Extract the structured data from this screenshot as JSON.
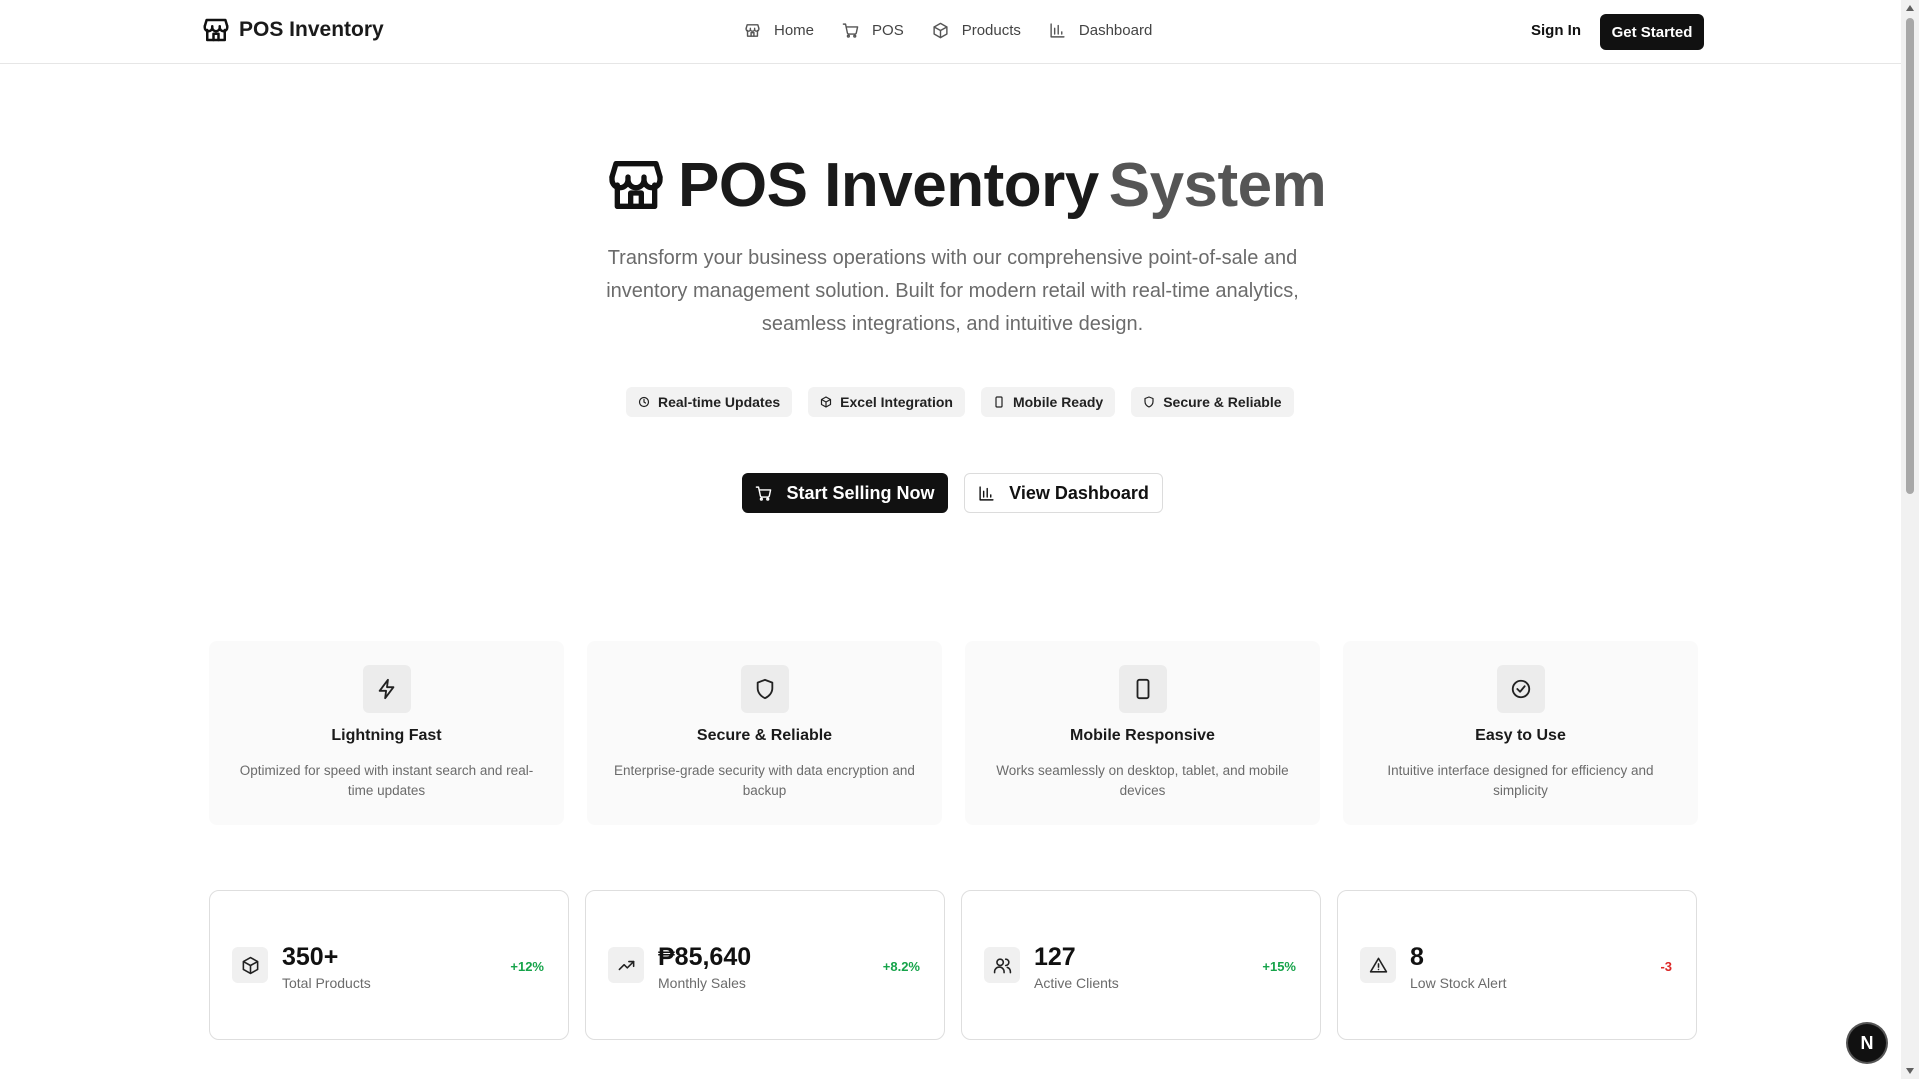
{
  "header": {
    "brand": "POS Inventory",
    "nav": [
      {
        "label": "Home",
        "icon": "store-icon"
      },
      {
        "label": "POS",
        "icon": "cart-icon"
      },
      {
        "label": "Products",
        "icon": "box-icon"
      },
      {
        "label": "Dashboard",
        "icon": "bar-chart-icon"
      }
    ],
    "sign_in": "Sign In",
    "get_started": "Get Started"
  },
  "hero": {
    "title_a": "POS Inventory",
    "title_b": "System",
    "subtitle": "Transform your business operations with our comprehensive point-of-sale and inventory management solution. Built for modern retail with real-time analytics, seamless integrations, and intuitive design.",
    "pills": [
      {
        "label": "Real-time Updates",
        "icon": "clock-icon"
      },
      {
        "label": "Excel Integration",
        "icon": "box-icon"
      },
      {
        "label": "Mobile Ready",
        "icon": "phone-icon"
      },
      {
        "label": "Secure & Reliable",
        "icon": "shield-icon"
      }
    ],
    "primary_cta": "Start Selling Now",
    "secondary_cta": "View Dashboard"
  },
  "features": [
    {
      "title": "Lightning Fast",
      "desc": "Optimized for speed with instant search and real-time updates",
      "icon": "bolt-icon"
    },
    {
      "title": "Secure & Reliable",
      "desc": "Enterprise-grade security with data encryption and backup",
      "icon": "shield-icon"
    },
    {
      "title": "Mobile Responsive",
      "desc": "Works seamlessly on desktop, tablet, and mobile devices",
      "icon": "tablet-icon"
    },
    {
      "title": "Easy to Use",
      "desc": "Intuitive interface designed for efficiency and simplicity",
      "icon": "check-circle-icon"
    }
  ],
  "stats": [
    {
      "value": "350+",
      "label": "Total Products",
      "change": "+12%",
      "icon": "box-icon",
      "color": "#16a34a"
    },
    {
      "value": "₱85,640",
      "label": "Monthly Sales",
      "change": "+8.2%",
      "icon": "trending-up-icon",
      "color": "#16a34a"
    },
    {
      "value": "127",
      "label": "Active Clients",
      "change": "+15%",
      "icon": "users-icon",
      "color": "#16a34a"
    },
    {
      "value": "8",
      "label": "Low Stock Alert",
      "change": "-3",
      "icon": "warning-icon",
      "color": "#dc2626"
    }
  ],
  "badge": "N",
  "colors": {
    "accent": "#111111",
    "positive": "#16a34a",
    "negative": "#dc2626"
  }
}
